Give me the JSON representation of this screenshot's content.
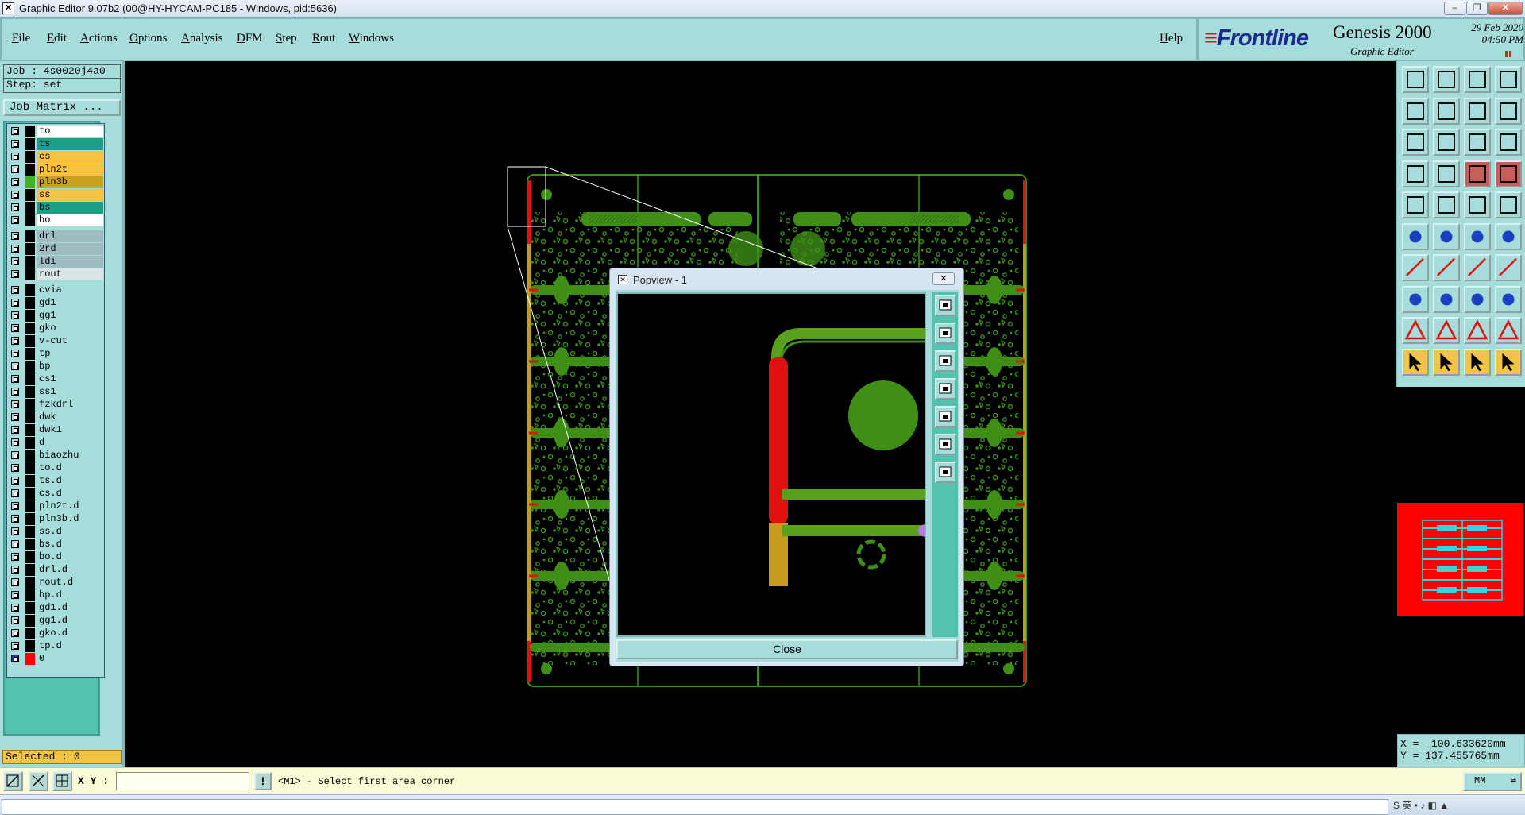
{
  "window": {
    "title": "Graphic Editor 9.07b2 (00@HY-HYCAM-PC185 - Windows, pid:5636)",
    "controls": [
      "–",
      "❐",
      "✕"
    ]
  },
  "menu": {
    "items": [
      "File",
      "Edit",
      "Actions",
      "Options",
      "Analysis",
      "DFM",
      "Step",
      "Rout",
      "Windows"
    ],
    "help": "Help"
  },
  "brand": {
    "logo": "Frontline",
    "product": "Genesis 2000",
    "subtitle": "Graphic Editor",
    "date_line": "29 Feb 2020",
    "time_line": "04:50 PM"
  },
  "job": {
    "job_label": "Job : 4s0020j4a0",
    "step_label": "Step: set",
    "matrix_button": "Job Matrix ..."
  },
  "layers": [
    {
      "name": "to",
      "color": "#ffffff",
      "swatch": "#000000"
    },
    {
      "name": "ts",
      "color": "#19a184",
      "swatch": "#000000"
    },
    {
      "name": "cs",
      "color": "#f7c23e",
      "swatch": "#000000"
    },
    {
      "name": "pln2t",
      "color": "#f7c23e",
      "swatch": "#000000"
    },
    {
      "name": "pln3b",
      "color": "#c8a020",
      "swatch": "#41b21f"
    },
    {
      "name": "ss",
      "color": "#f7c23e",
      "swatch": "#000000"
    },
    {
      "name": "bs",
      "color": "#19a184",
      "swatch": "#000000"
    },
    {
      "name": "bo",
      "color": "#ffffff",
      "swatch": "#000000"
    },
    {
      "name": "drl",
      "color": "#9fbcc1",
      "swatch": "#000000",
      "gap": true
    },
    {
      "name": "2rd",
      "color": "#9fbcc1",
      "swatch": "#000000"
    },
    {
      "name": "ldi",
      "color": "#9fbcc1",
      "swatch": "#000000"
    },
    {
      "name": "rout",
      "color": "#d9e4e6",
      "swatch": "#000000"
    },
    {
      "name": "cvia",
      "color": "#a6dcda",
      "swatch": "#000000",
      "gap": true
    },
    {
      "name": "gd1",
      "color": "#a6dcda",
      "swatch": "#000000"
    },
    {
      "name": "gg1",
      "color": "#a6dcda",
      "swatch": "#000000"
    },
    {
      "name": "gko",
      "color": "#a6dcda",
      "swatch": "#000000"
    },
    {
      "name": "v-cut",
      "color": "#a6dcda",
      "swatch": "#000000"
    },
    {
      "name": "tp",
      "color": "#a6dcda",
      "swatch": "#000000"
    },
    {
      "name": "bp",
      "color": "#a6dcda",
      "swatch": "#000000"
    },
    {
      "name": "cs1",
      "color": "#a6dcda",
      "swatch": "#000000"
    },
    {
      "name": "ss1",
      "color": "#a6dcda",
      "swatch": "#000000"
    },
    {
      "name": "fzkdrl",
      "color": "#a6dcda",
      "swatch": "#000000"
    },
    {
      "name": "dwk",
      "color": "#a6dcda",
      "swatch": "#000000"
    },
    {
      "name": "dwk1",
      "color": "#a6dcda",
      "swatch": "#000000"
    },
    {
      "name": "d",
      "color": "#a6dcda",
      "swatch": "#000000"
    },
    {
      "name": "biaozhu",
      "color": "#a6dcda",
      "swatch": "#000000"
    },
    {
      "name": "to.d",
      "color": "#a6dcda",
      "swatch": "#000000"
    },
    {
      "name": "ts.d",
      "color": "#a6dcda",
      "swatch": "#000000"
    },
    {
      "name": "cs.d",
      "color": "#a6dcda",
      "swatch": "#000000"
    },
    {
      "name": "pln2t.d",
      "color": "#a6dcda",
      "swatch": "#000000"
    },
    {
      "name": "pln3b.d",
      "color": "#a6dcda",
      "swatch": "#000000"
    },
    {
      "name": "ss.d",
      "color": "#a6dcda",
      "swatch": "#000000"
    },
    {
      "name": "bs.d",
      "color": "#a6dcda",
      "swatch": "#000000"
    },
    {
      "name": "bo.d",
      "color": "#a6dcda",
      "swatch": "#000000"
    },
    {
      "name": "drl.d",
      "color": "#a6dcda",
      "swatch": "#000000"
    },
    {
      "name": "rout.d",
      "color": "#a6dcda",
      "swatch": "#000000"
    },
    {
      "name": "bp.d",
      "color": "#a6dcda",
      "swatch": "#000000"
    },
    {
      "name": "gd1.d",
      "color": "#a6dcda",
      "swatch": "#000000"
    },
    {
      "name": "gg1.d",
      "color": "#a6dcda",
      "swatch": "#000000"
    },
    {
      "name": "gko.d",
      "color": "#a6dcda",
      "swatch": "#000000"
    },
    {
      "name": "tp.d",
      "color": "#a6dcda",
      "swatch": "#000000"
    },
    {
      "name": "0",
      "color": "#a6dcda",
      "swatch": "#ff0000",
      "special": true
    }
  ],
  "selected": "Selected : 0",
  "popview": {
    "title": "Popview - 1",
    "close_label": "Close",
    "tools": [
      "zoom-home-icon",
      "move-up-icon",
      "move-down-icon",
      "move-left-icon",
      "move-right-icon",
      "zoom-fit-icon",
      "pan-center-icon"
    ]
  },
  "toolbox": {
    "rows": [
      [
        "page-up-icon",
        "page-down-icon",
        "home-icon",
        "split-view-icon"
      ],
      [
        "page-left-icon",
        "page-right-icon",
        "snap-icon",
        "s-curve-icon"
      ],
      [
        "fit-icon",
        "center-icon",
        "scale-1to2-icon",
        "query-icon"
      ],
      [
        "measure-icon",
        "pin-icon",
        "layers-icon",
        "layer-compare-icon"
      ],
      [
        "camera-icon",
        "display-icon",
        "ruler-icon",
        "circle-icon"
      ],
      [
        "connect-icon",
        "cross-icon",
        "point-line-icon",
        "point-line-2-icon"
      ],
      [
        "line-icon",
        "slant-line-icon",
        "arc-icon",
        "align-icon"
      ],
      [
        "pad-icon",
        "dash-icon",
        "snap-grid-icon",
        "polygon-icon"
      ],
      [
        "triangle-icon",
        "text-a-icon",
        "text-b-icon",
        "text-c-icon"
      ],
      [
        "select-arrow-icon",
        "select-arrow-2-icon",
        "select-arrow-3-icon",
        "route-select-icon"
      ]
    ]
  },
  "coords": {
    "x": "X = -100.633620mm",
    "y": "Y = 137.455765mm"
  },
  "status": {
    "xy_label": "X Y :",
    "xy_value": "",
    "warn": "!",
    "prompt": "<M1> - Select first area corner",
    "units": "MM"
  },
  "colors": {
    "panel": "#a6dcda",
    "copper": "#3f8f17",
    "red_trace": "#e01111",
    "gold_trace": "#c69a1c"
  }
}
